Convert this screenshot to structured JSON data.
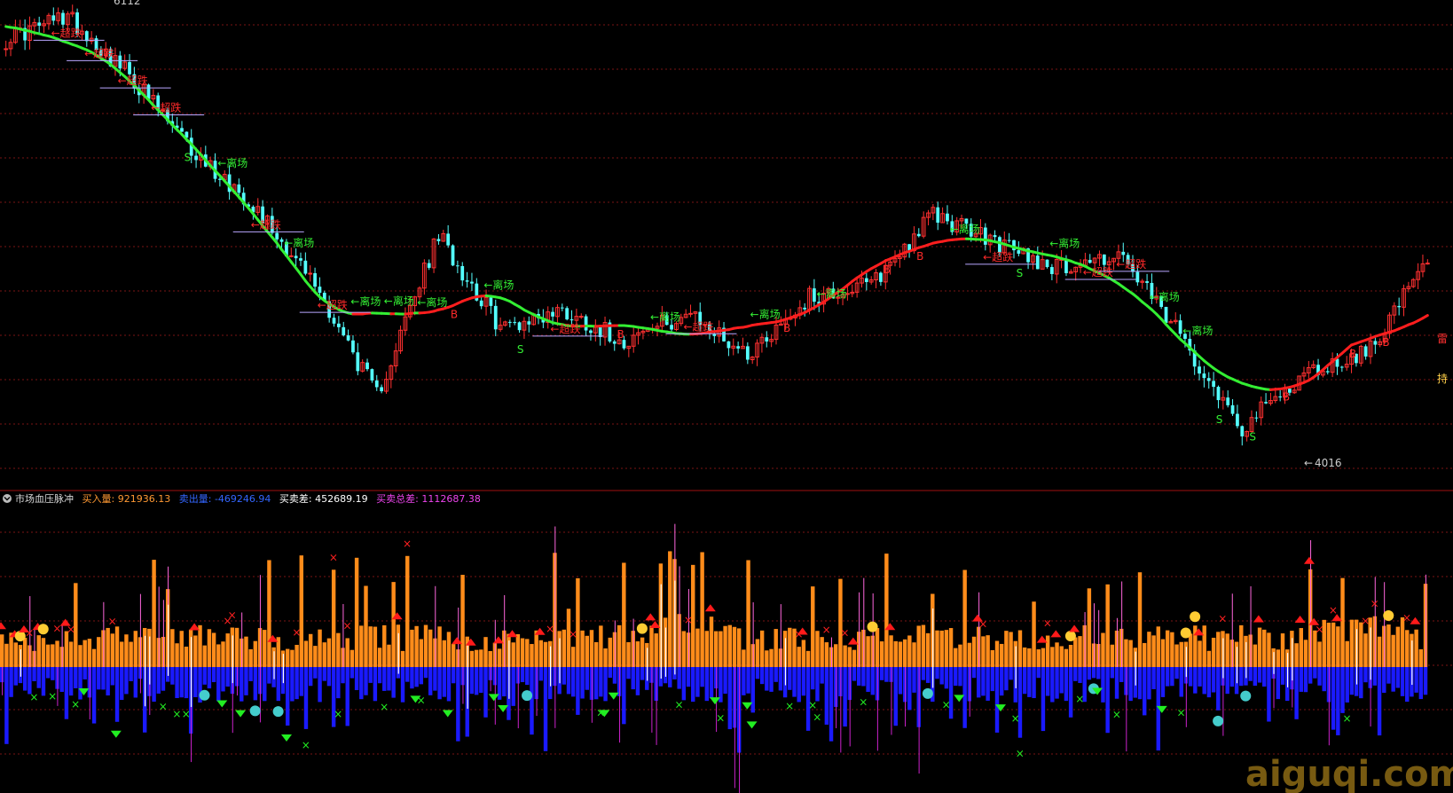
{
  "colors": {
    "background": "#000000",
    "grid": "#7a1414",
    "separator": "#a01010",
    "candle_up": "#ff3030",
    "candle_down": "#54ffff",
    "ma_up": "#ff1e1e",
    "ma_down": "#33ee33",
    "signal_green": "#33ee33",
    "signal_red": "#ff2a2a",
    "support_line": "#b9a6ff",
    "buy_bar": "#ff8c1a",
    "sell_bar": "#1a1aff",
    "buy_line": "#ff66dd",
    "sell_line": "#cc22cc",
    "white_line": "#ffffff",
    "x_red": "#ff2020",
    "x_green": "#22ee22",
    "tri_up": "#ff1a1a",
    "tri_down": "#22ee22",
    "watermark": "#d9a520",
    "header_label": "#d8d8d8",
    "buy_value": "#ff9933",
    "sell_value": "#3366ff",
    "diff_value": "#ffffff",
    "total_value": "#ee44ee"
  },
  "indicator_header": {
    "icon": "circle-chevron-down-icon",
    "name": "市场血压脉冲",
    "buy_label": "买入量:",
    "buy_value": "921936.13",
    "sell_label": "卖出量:",
    "sell_value": "-469246.94",
    "diff_label": "买卖差:",
    "diff_value": "452689.19",
    "total_label": "买卖总差:",
    "total_value": "1112687.38"
  },
  "watermark": "aiguqi.com",
  "chart_data": [
    {
      "type": "candlestick",
      "title": "",
      "price_labels": {
        "high": "6112",
        "low": "4016"
      },
      "price_range": [
        3960,
        6120
      ],
      "close_path": [
        5970,
        6080,
        5800,
        5450,
        5200,
        4820,
        4300,
        5050,
        4620,
        4700,
        4560,
        4680,
        4500,
        4760,
        4820,
        5150,
        5020,
        4900,
        4960,
        4580,
        4150,
        4400,
        4500,
        4920
      ],
      "signal_labels": {
        "exit": "←离场",
        "oversold": "←超跌",
        "buy": "B",
        "sell": "S"
      },
      "edge_labels": [
        "雷",
        "持"
      ]
    },
    {
      "type": "bar",
      "title": "市场血压脉冲",
      "series": [
        {
          "name": "买入量",
          "value": 921936.13
        },
        {
          "name": "卖出量",
          "value": -469246.94
        },
        {
          "name": "买卖差",
          "value": 452689.19
        },
        {
          "name": "买卖总差",
          "value": 1112687.38
        }
      ]
    }
  ]
}
